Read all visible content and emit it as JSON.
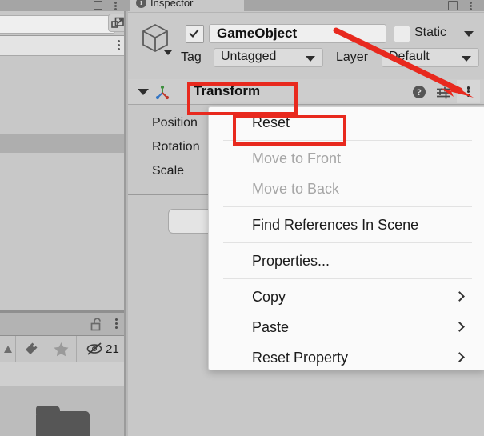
{
  "left_panel": {
    "name": "hierarchy-project-panel",
    "search_value": "",
    "visibility_count": "21",
    "icons": [
      "triangle-icon",
      "tag-icon",
      "star-icon",
      "eye-off-icon"
    ]
  },
  "inspector": {
    "tab_label": "Inspector",
    "tab_icon": "info-icon",
    "game_object": {
      "active": true,
      "name_value": "GameObject",
      "static_label": "Static",
      "static_checked": false,
      "tag_label": "Tag",
      "tag_value": "Untagged",
      "layer_label": "Layer",
      "layer_value": "Default"
    },
    "transform": {
      "title": "Transform",
      "expanded": true,
      "properties": [
        {
          "label": "Position"
        },
        {
          "label": "Rotation"
        },
        {
          "label": "Scale"
        }
      ],
      "help_glyph": "?",
      "icons": [
        "help-icon",
        "preset-icon",
        "kebab-menu-icon"
      ]
    },
    "add_component_label": ""
  },
  "context_menu": {
    "items": [
      {
        "label": "Reset",
        "disabled": false,
        "submenu": false,
        "separator_after": true
      },
      {
        "label": "Move to Front",
        "disabled": true,
        "submenu": false,
        "separator_after": false
      },
      {
        "label": "Move to Back",
        "disabled": true,
        "submenu": false,
        "separator_after": true
      },
      {
        "label": "Find References In Scene",
        "disabled": false,
        "submenu": false,
        "separator_after": true
      },
      {
        "label": "Properties...",
        "disabled": false,
        "submenu": false,
        "separator_after": true
      },
      {
        "label": "Copy",
        "disabled": false,
        "submenu": true,
        "separator_after": false
      },
      {
        "label": "Paste",
        "disabled": false,
        "submenu": true,
        "separator_after": false
      },
      {
        "label": "Reset Property",
        "disabled": false,
        "submenu": true,
        "separator_after": false
      }
    ]
  },
  "annotations": {
    "highlight_color": "#e8291e",
    "boxes": [
      "transform-header",
      "reset-menu-item"
    ],
    "arrow": {
      "from": "gameobject-name-field",
      "to": "transform-kebab-menu"
    }
  }
}
